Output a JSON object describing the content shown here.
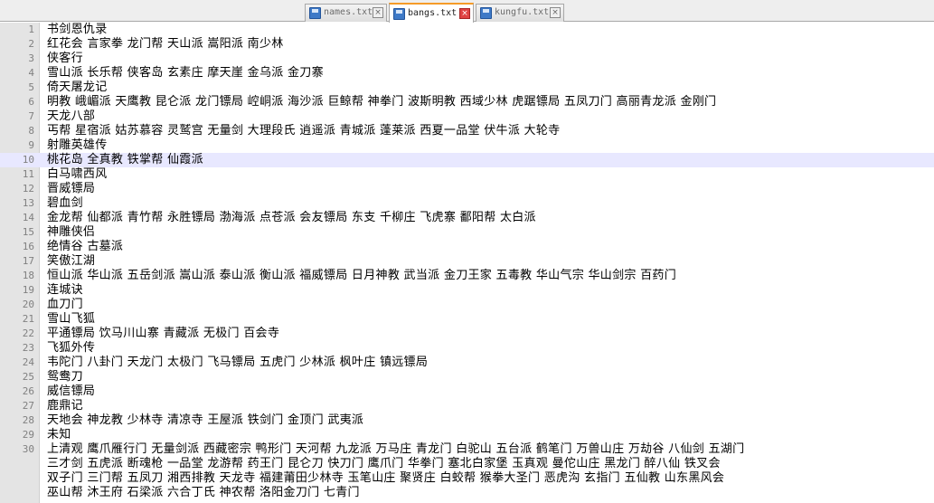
{
  "tabs": [
    {
      "label": "names.txt",
      "active": false
    },
    {
      "label": "bangs.txt",
      "active": true
    },
    {
      "label": "kungfu.txt",
      "active": false
    }
  ],
  "close_glyph": "×",
  "current_line": 10,
  "lines": [
    "书剑恩仇录",
    "红花会 言家拳 龙门帮 天山派 嵩阳派 南少林",
    "侠客行",
    "雪山派 长乐帮 侠客岛 玄素庄 摩天崖 金乌派 金刀寨",
    "倚天屠龙记",
    "明教 峨嵋派 天鹰教 昆仑派 龙门镖局 崆峒派 海沙派 巨鲸帮 神拳门 波斯明教 西域少林 虎踞镖局 五凤刀门 高丽青龙派 金刚门",
    "天龙八部",
    "丐帮 星宿派 姑苏慕容 灵鹫宫 无量剑 大理段氏 逍遥派 青城派 蓬莱派 西夏一品堂 伏牛派 大轮寺",
    "射雕英雄传",
    "桃花岛 全真教 铁掌帮 仙霞派",
    "白马啸西风",
    "晋威镖局",
    "碧血剑",
    "金龙帮 仙都派 青竹帮 永胜镖局 渤海派 点苍派 会友镖局 东支 千柳庄 飞虎寨 鄱阳帮 太白派",
    "神雕侠侣",
    "绝情谷 古墓派",
    "笑傲江湖",
    "恒山派 华山派 五岳剑派 嵩山派 泰山派 衡山派 福威镖局 日月神教 武当派 金刀王家 五毒教 华山气宗 华山剑宗 百药门",
    "连城诀",
    "血刀门",
    "雪山飞狐",
    "平通镖局 饮马川山寨 青藏派 无极门 百会寺",
    "飞狐外传",
    "韦陀门 八卦门 天龙门 太极门 飞马镖局 五虎门 少林派 枫叶庄 镇远镖局",
    "鸳鸯刀",
    "威信镖局",
    "鹿鼎记",
    "天地会 神龙教 少林寺 清凉寺 王屋派 铁剑门 金顶门 武夷派",
    "未知",
    "上清观 鹰爪雁行门 无量剑派 西藏密宗 鸭形门 天河帮 九龙派 万马庄 青龙门 白驼山 五台派 鹤笔门 万兽山庄 万劫谷 八仙剑 五湖门",
    "三才剑 五虎派 断魂枪 一品堂 龙游帮 药王门 昆仑刀 快刀门 鹰爪门 华拳门 塞北白家堡 玉真观 曼佗山庄 黑龙门 醉八仙 铁叉会",
    "双子门 三门帮 五凤刀 湘西排教 天龙寺 福建莆田少林寺 玉笔山庄 聚贤庄 白蛟帮 猴拳大圣门 恶虎沟 玄指门 五仙教 山东黑风会",
    "巫山帮 沐王府 石梁派 六合丁氏 神农帮 洛阳金刀门 七青门"
  ],
  "line_numbers": [
    "1",
    "2",
    "3",
    "4",
    "5",
    "6",
    "7",
    "8",
    "9",
    "10",
    "11",
    "12",
    "13",
    "14",
    "15",
    "16",
    "17",
    "18",
    "19",
    "20",
    "21",
    "22",
    "23",
    "24",
    "25",
    "26",
    "27",
    "28",
    "29",
    "30",
    "",
    "",
    ""
  ]
}
